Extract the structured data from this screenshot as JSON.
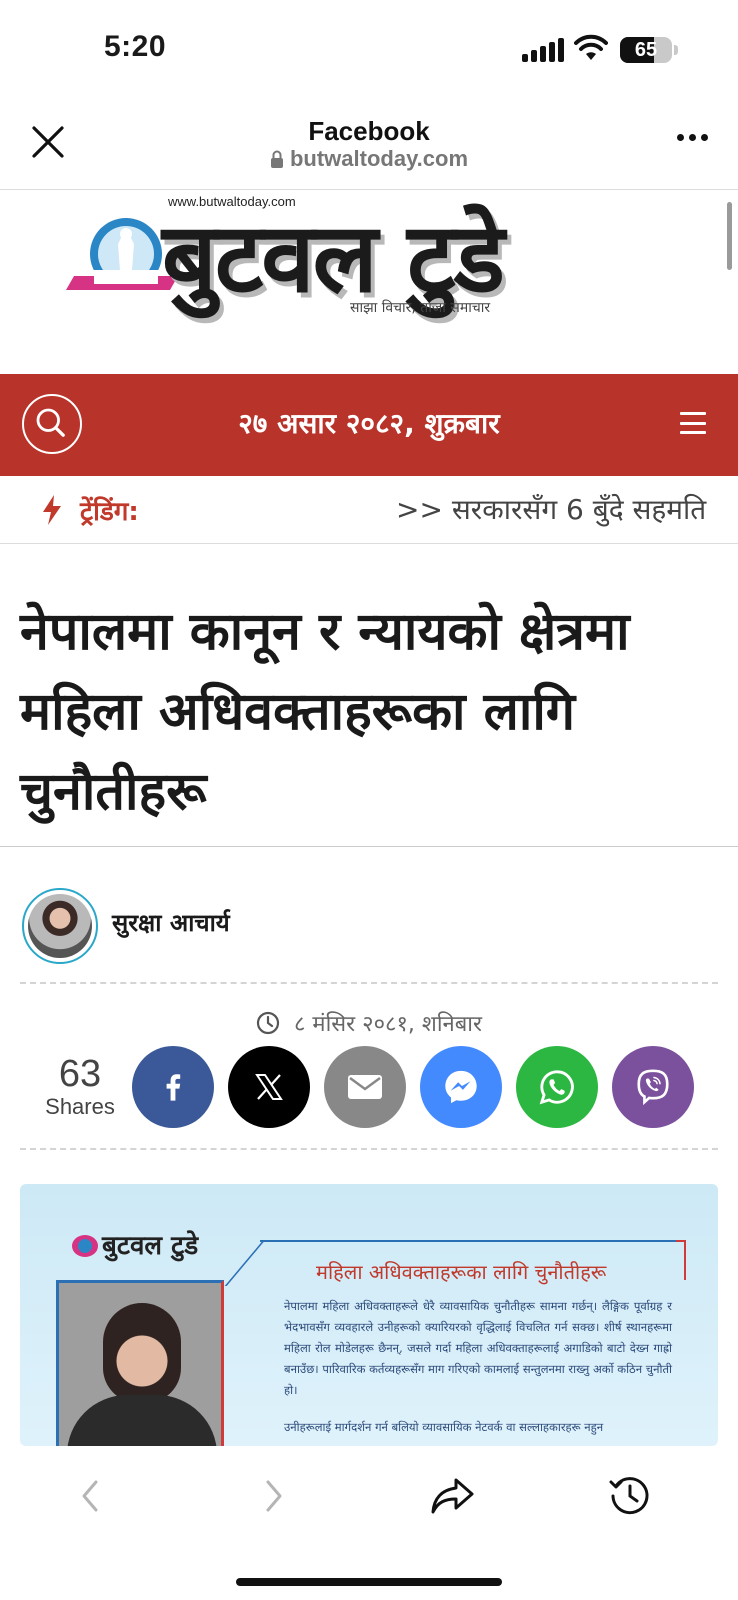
{
  "status_bar": {
    "time": "5:20",
    "battery_level": "65",
    "battery_fraction": 0.65
  },
  "browser": {
    "title": "Facebook",
    "url": "butwaltoday.com"
  },
  "masthead": {
    "site_url": "www.butwaltoday.com",
    "title": "बुटवल टुडे",
    "tagline": "साझा विचार, ताजा समाचार"
  },
  "nav": {
    "date": "२७ असार २०८२, शुक्रबार"
  },
  "trending": {
    "label": "ट्रेंडिंग:",
    "ticker": ">> सरकारसँग 6 बुँदे सहमति"
  },
  "article": {
    "headline": "नेपालमा कानून र न्यायको क्षेत्रमा महिला अधिवक्ताहरूका लागि चुनौतीहरू",
    "author": "सुरक्षा आचार्य",
    "date": "८ मंसिर २०८१, शनिबार"
  },
  "share": {
    "count": "63",
    "label": "Shares",
    "buttons": [
      "facebook",
      "x",
      "email",
      "messenger",
      "whatsapp",
      "viber"
    ]
  },
  "article_image": {
    "logo": "बुटवल टुडे",
    "title": "महिला अधिवक्ताहरूका लागि चुनौतीहरू",
    "body": "नेपालमा महिला अधिवक्ताहरूले धेरै व्यावसायिक चुनौतीहरू सामना गर्छन्। लैङ्गिक पूर्वाग्रह र भेदभावसँग व्यवहारले उनीहरूको क्यारियरको वृद्धिलाई विचलित गर्न सक्छ। शीर्ष स्थानहरूमा महिला रोल मोडेलहरू छैनन्, जसले गर्दा महिला अधिवक्ताहरूलाई अगाडिको बाटो देख्न गाह्रो बनाउँछ। पारिवारिक कर्तव्यहरूसँग माग गरिएको कामलाई सन्तुलनमा राख्नु अर्को कठिन चुनौती हो।",
    "body2": "उनीहरूलाई मार्गदर्शन गर्न बलियो व्यावसायिक नेटवर्क वा सल्लाहकारहरू नहुन"
  },
  "icons": {
    "close": "close-icon",
    "lock": "lock-icon",
    "more": "more-icon",
    "search": "search-icon",
    "menu": "hamburger-icon",
    "bolt": "lightning-icon",
    "clock": "clock-icon",
    "back": "chevron-left-icon",
    "forward": "chevron-right-icon",
    "share": "share-arrow-icon",
    "history": "history-icon"
  },
  "colors": {
    "nav_red": "#b8332a",
    "trending_red": "#c0392b",
    "facebook": "#3b5998",
    "x": "#000000",
    "email": "#888888",
    "messenger": "#448aff",
    "whatsapp": "#2bb741",
    "viber": "#7b519d"
  }
}
